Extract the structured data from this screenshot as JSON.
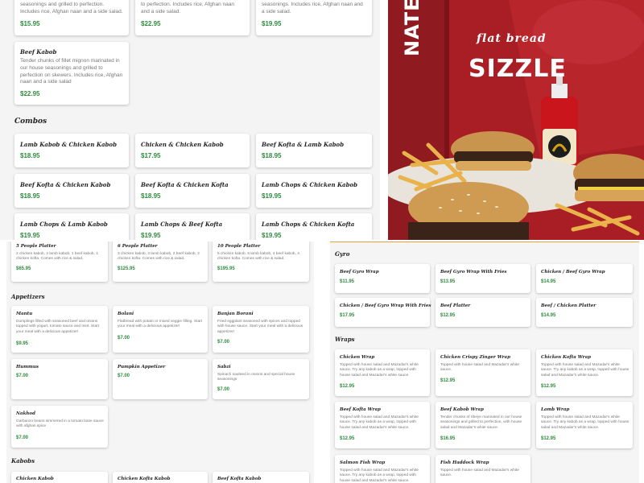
{
  "top": {
    "partial_cards": [
      {
        "desc": "seasonings and grilled to perfection. Includes rice, Afghan naan and a side salad.",
        "price": "$15.95"
      },
      {
        "desc": "to perfection. Includes rice, Afghan naan and a side salad.",
        "price": "$22.95"
      },
      {
        "desc": "seasonings. Includes rice, Afghan naan and a side salad.",
        "price": "$19.95"
      }
    ],
    "beef_kabob": {
      "name": "Beef Kabob",
      "desc": "Tender chunks of fillet mignon marinated in our house seasonings and grilled to perfection on skewers. Includes rice, Afghan naan and a side salad",
      "price": "$22.95"
    },
    "combos_title": "Combos",
    "combos": [
      {
        "name": "Lamb Kabob & Chicken Kabob",
        "price": "$18.95"
      },
      {
        "name": "Chicken & Chicken Kabob",
        "price": "$17.95"
      },
      {
        "name": "Beef Kofta & Lamb Kabob",
        "price": "$18.95"
      },
      {
        "name": "Beef Kofta & Chicken Kabob",
        "price": "$18.95"
      },
      {
        "name": "Beef Kofta & Chicken Kofta",
        "price": "$18.95"
      },
      {
        "name": "Lamb Chops & Chicken Kabob",
        "price": "$19.95"
      },
      {
        "name": "Lamb Chops & Lamb Kabob",
        "price": "$19.95"
      },
      {
        "name": "Lamb Chops & Beef Kofta",
        "price": "$19.95"
      },
      {
        "name": "Lamb Chops & Chicken Kofta",
        "price": "$19.95"
      }
    ]
  },
  "photo": {
    "sign_left": "NATED",
    "sign_mid": "flat bread",
    "sign_right": "SIZZLE"
  },
  "bottom_left": {
    "platters": [
      {
        "name": "5 People Platter",
        "desc": "2 chicken kabob, 2 lamb kabob, 1 beef kabob, 1 chicken kofta. Comes with rice & salad.",
        "price": "$65.95"
      },
      {
        "name": "6 People Platter",
        "desc": "3 chicken kabob, 3 lamb kabob, 2 beef kabob, 2 chicken kofta. Comes with rice & salad.",
        "price": "$125.95"
      },
      {
        "name": "10 People Platter",
        "desc": "5 chicken kabob, 5 lamb kabob, 4 beef kabob, 4 chicken kofta. Comes with rice & salad.",
        "price": "$195.95"
      }
    ],
    "appetizers_title": "Appetizers",
    "appetizers": [
      {
        "name": "Mantu",
        "desc": "Dumplings filled with seasoned beef and onions topped with yogurt, tomato sauce and mint. Start your meal with a delicious appetizer!",
        "price": "$9.95"
      },
      {
        "name": "Bolani",
        "desc": "Flatbread with potato or mixed veggie filling. Start your meal with a delicious appetizer!",
        "price": "$7.00"
      },
      {
        "name": "Banjan Borani",
        "desc": "Fried eggplant seasoned with spices and topped with house sauce. Start your meal with a delicious appetizer!",
        "price": "$7.00"
      },
      {
        "name": "Hummus",
        "desc": "",
        "price": "$7.00"
      },
      {
        "name": "Pumpkin Appetizer",
        "desc": "",
        "price": "$7.00"
      },
      {
        "name": "Sabzi",
        "desc": "Spinach sauteed in onions and special house seasonings",
        "price": "$7.00"
      },
      {
        "name": "Nakhod",
        "desc": "Garbanzo beans simmered in a tomato base sauce with afghan spice",
        "price": "$7.00"
      }
    ],
    "kabobs_title": "Kabobs",
    "kabobs": [
      {
        "name": "Chicken Kabob"
      },
      {
        "name": "Chicken Kofta Kabob"
      },
      {
        "name": "Beef Kofta Kabob"
      }
    ]
  },
  "bottom_right": {
    "gyro_title": "Gyro",
    "gyros": [
      {
        "name": "Beef Gyro Wrap",
        "price": "$11.95"
      },
      {
        "name": "Beef Gyro Wrap With Fries",
        "price": "$13.95"
      },
      {
        "name": "Chicken / Beef Gyro Wrap",
        "price": "$14.95"
      },
      {
        "name": "Chicken / Beef Gyro Wrap With Fries",
        "price": "$17.95"
      },
      {
        "name": "Beef Platter",
        "price": "$12.95"
      },
      {
        "name": "Beef / Chicken Platter",
        "price": "$14.95"
      }
    ],
    "wraps_title": "Wraps",
    "wraps": [
      {
        "name": "Chicken Wrap",
        "desc": "Topped with house salad and Mazadar's white sauce. Try any kabob as a wrap, topped with house salad and Mazadar's white sauce.",
        "price": "$12.95"
      },
      {
        "name": "Chicken Crispy Zinger Wrap",
        "desc": "Topped with house salad and Mazadar's white sauce.",
        "price": "$12.95"
      },
      {
        "name": "Chicken Kofta Wrap",
        "desc": "Topped with house salad and Mazadar's white sauce. Try any kabob as a wrap, topped with house salad and Mazadar's white sauce.",
        "price": "$12.95"
      },
      {
        "name": "Beef Kofta Wrap",
        "desc": "Topped with house salad and Mazadar's white sauce. Try any kabob as a wrap, topped with house salad and Mazadar's white sauce.",
        "price": "$12.95"
      },
      {
        "name": "Beef Kabob Wrap",
        "desc": "Tender chunks of ribeye marinated in our house seasonings and grilled to perfection, with house salad and Mazadar's white sauce.",
        "price": "$16.95"
      },
      {
        "name": "Lamb Wrap",
        "desc": "Topped with house salad and Mazadar's white sauce. Try any kabob as a wrap, topped with house salad and Mazadar's white sauce.",
        "price": "$12.95"
      },
      {
        "name": "Salmon Fish Wrap",
        "desc": "Topped with house salad and Mazadar's white sauce. Try any kabob as a wrap, topped with house salad and Mazadar's white sauce.",
        "price": ""
      },
      {
        "name": "Fish Haddock Wrap",
        "desc": "Topped with house salad and Mazadar's white sauce.",
        "price": ""
      }
    ]
  }
}
